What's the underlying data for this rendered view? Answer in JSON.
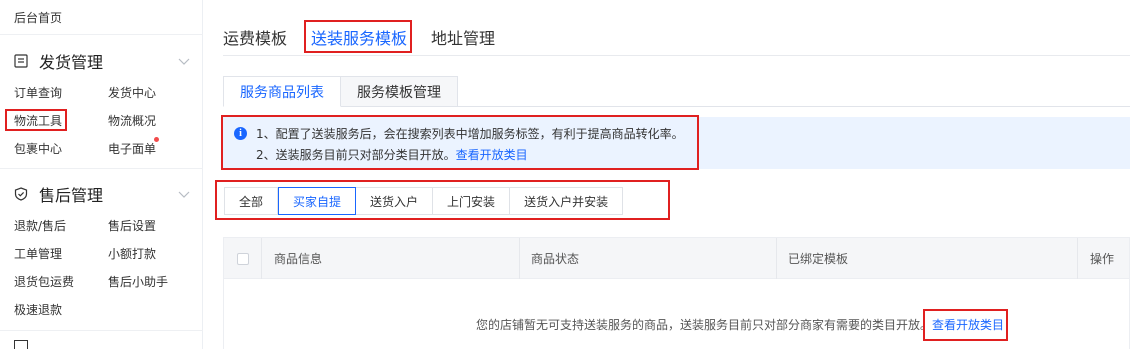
{
  "sidebar": {
    "home": "后台首页",
    "sections": [
      {
        "icon": "list-doc-icon",
        "title": "发货管理",
        "items": [
          "订单查询",
          "发货中心",
          "物流工具",
          "物流概况",
          "包裹中心",
          "电子面单"
        ]
      },
      {
        "icon": "shield-check-icon",
        "title": "售后管理",
        "items": [
          "退款/售后",
          "售后设置",
          "工单管理",
          "小额打款",
          "退货包运费",
          "售后小助手",
          "极速退款"
        ]
      }
    ]
  },
  "main": {
    "top_tabs": [
      "运费模板",
      "送装服务模板",
      "地址管理"
    ],
    "sub_tabs": [
      "服务商品列表",
      "服务模板管理"
    ],
    "info": {
      "line1": "1、配置了送装服务后，会在搜索列表中增加服务标签，有利于提高商品转化率。",
      "line2_text": "2、送装服务目前只对部分类目开放。",
      "line2_link": "查看开放类目"
    },
    "filters": [
      "全部",
      "买家自提",
      "送货入户",
      "上门安装",
      "送货入户并安装"
    ],
    "table": {
      "headers": [
        "商品信息",
        "商品状态",
        "已绑定模板",
        "操作"
      ],
      "empty_text": "您的店铺暂无可支持送装服务的商品，送装服务目前只对部分商家有需要的类目开放。",
      "empty_link": "查看开放类目"
    }
  },
  "colors": {
    "accent": "#1966ff",
    "highlight_box": "#e02020",
    "info_bg": "#ebf3ff"
  }
}
